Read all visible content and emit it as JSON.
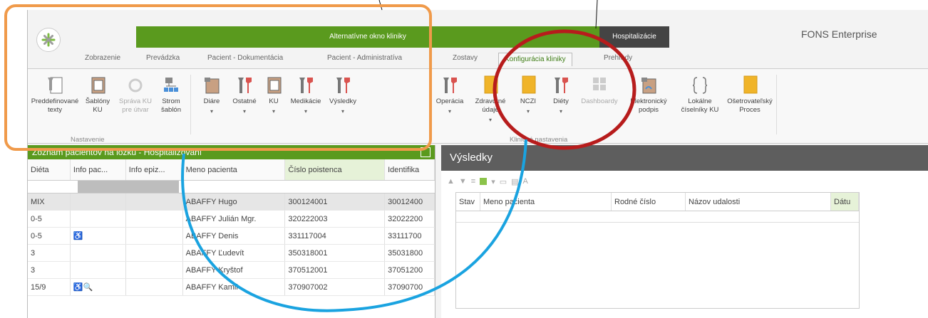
{
  "app": {
    "context_tab_green": "Alternatívne okno kliniky",
    "context_tab_dark": "Hospitalizácie",
    "brand": "FONS Enterprise"
  },
  "tabs": [
    {
      "label": "Zobrazenie"
    },
    {
      "label": "Prevádzka"
    },
    {
      "label": "Pacient - Dokumentácia"
    },
    {
      "label": "Pacient - Administratíva"
    },
    {
      "label": "Zostavy"
    },
    {
      "label": "Konfigurácia kliniky",
      "active": true
    },
    {
      "label": "Prehľady"
    }
  ],
  "ribbon": {
    "buttons": [
      {
        "label": "Preddefinované texty",
        "icon": "wrench-document-icon"
      },
      {
        "label": "Šablóny KU",
        "icon": "template-icon"
      },
      {
        "label": "Správa KU pre útvar",
        "icon": "gear-icon",
        "disabled": true
      },
      {
        "label": "Strom šablón",
        "icon": "tree-icon"
      },
      {
        "label": "Diáre",
        "icon": "diary-icon"
      },
      {
        "label": "Ostatné",
        "icon": "tools-icon"
      },
      {
        "label": "KU",
        "icon": "template-icon"
      },
      {
        "label": "Medikácie",
        "icon": "tools-icon"
      },
      {
        "label": "Výsledky",
        "icon": "tools-icon"
      },
      {
        "label": "Operácia",
        "icon": "tools-icon"
      },
      {
        "label": "Zdravotné údaje",
        "icon": "folder-icon"
      },
      {
        "label": "NCZI",
        "icon": "folder-icon"
      },
      {
        "label": "Diéty",
        "icon": "tools-icon"
      },
      {
        "label": "Dashboardy",
        "icon": "dashboard-icon",
        "disabled": true
      },
      {
        "label": "Elektronický podpis",
        "icon": "signature-icon"
      },
      {
        "label": "Lokálne číselníky KU",
        "icon": "bracket-icon"
      },
      {
        "label": "Ošetrovateľský Proces",
        "icon": "folder-icon"
      }
    ],
    "groups": [
      "Nastavenie",
      "Klinické nastavenia"
    ]
  },
  "left_panel": {
    "title": "Zoznam pacientov na lôžku - Hospitalizovaní",
    "columns": [
      "Diéta",
      "Info pac...",
      "Info epiz...",
      "Meno pacienta",
      "Číslo poistenca",
      "Identifika"
    ],
    "rows": [
      {
        "dieta": "MIX",
        "info": "",
        "meno": "ABAFFY Hugo",
        "cislo": "300124001",
        "ident": "30012400"
      },
      {
        "dieta": "0-5",
        "info": "",
        "meno": "ABAFFY Julián Mgr.",
        "cislo": "320222003",
        "ident": "32022200"
      },
      {
        "dieta": "0-5",
        "info": "♿",
        "meno": "ABAFFY Denis",
        "cislo": "331117004",
        "ident": "33111700"
      },
      {
        "dieta": "3",
        "info": "",
        "meno": "ABAFFY Ľudevít",
        "cislo": "350318001",
        "ident": "35031800"
      },
      {
        "dieta": "3",
        "info": "",
        "meno": "ABAFFY Kryštof",
        "cislo": "370512001",
        "ident": "37051200"
      },
      {
        "dieta": "15/9",
        "info": "♿🔍",
        "meno": "ABAFFY Kamil",
        "cislo": "370907002",
        "ident": "37090700"
      }
    ]
  },
  "right_panel": {
    "title": "Výsledky",
    "columns": [
      "Stav",
      "Meno pacienta",
      "Rodné číslo",
      "Názov udalosti",
      "Dátu"
    ]
  }
}
